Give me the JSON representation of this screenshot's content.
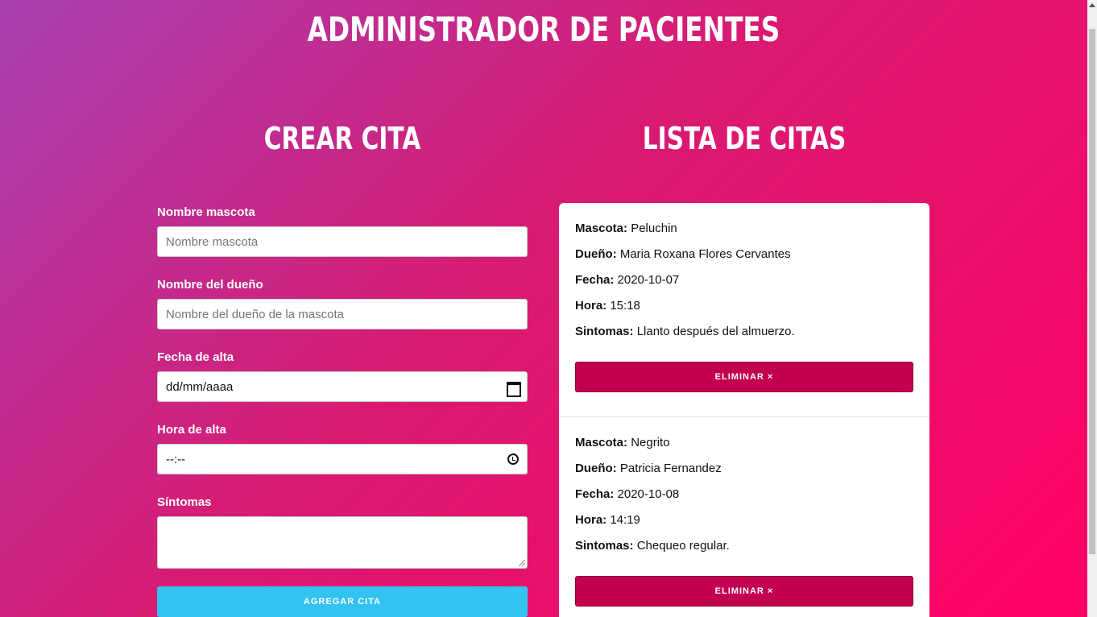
{
  "header": {
    "title": "ADMINISTRADOR DE PACIENTES"
  },
  "form": {
    "title": "CREAR CITA",
    "fields": [
      {
        "label": "Nombre mascota",
        "placeholder": "Nombre mascota"
      },
      {
        "label": "Nombre del dueño",
        "placeholder": "Nombre del dueño de la mascota"
      },
      {
        "label": "Fecha de alta",
        "value": "dd/mm/aaaa",
        "icon": "calendar-icon"
      },
      {
        "label": "Hora de alta",
        "value": "--:--",
        "icon": "clock-icon"
      },
      {
        "label": "Síntomas"
      }
    ],
    "submit_label": "AGREGAR CITA"
  },
  "list": {
    "title": "LISTA DE CITAS",
    "citas": [
      {
        "mascota_label": "Mascota:",
        "mascota": "Peluchin",
        "dueno_label": "Dueño:",
        "dueno": "Maria Roxana Flores Cervantes",
        "fecha_label": "Fecha:",
        "fecha": "2020-10-07",
        "hora_label": "Hora:",
        "hora": "15:18",
        "sintomas_label": "Sintomas:",
        "sintomas": "Llanto después del almuerzo.",
        "delete_label": "ELIMINAR ×"
      },
      {
        "mascota_label": "Mascota:",
        "mascota": "Negrito",
        "dueno_label": "Dueño:",
        "dueno": "Patricia Fernandez",
        "fecha_label": "Fecha:",
        "fecha": "2020-10-08",
        "hora_label": "Hora:",
        "hora": "14:19",
        "sintomas_label": "Sintomas:",
        "sintomas": "Chequeo regular.",
        "delete_label": "ELIMINAR ×"
      }
    ]
  },
  "colors": {
    "submit": "#33c3f0",
    "delete": "#c2004f",
    "gradient_start": "#a73fb0",
    "gradient_end": "#ff0063"
  }
}
